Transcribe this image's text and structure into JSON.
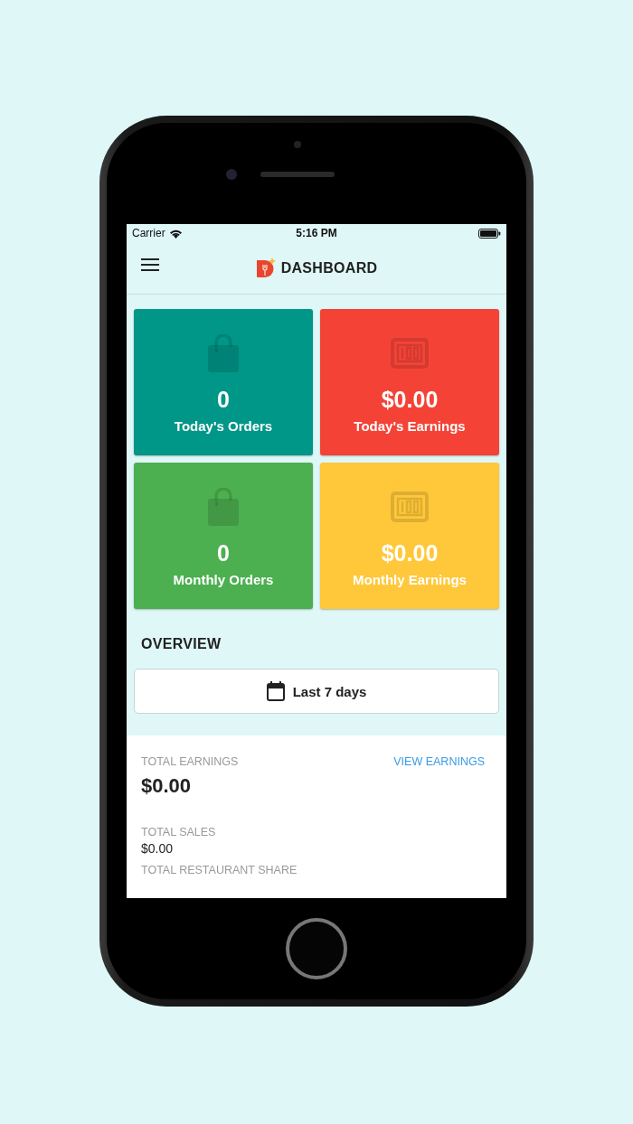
{
  "status_bar": {
    "carrier": "Carrier",
    "time": "5:16 PM"
  },
  "nav_bar": {
    "title": "DASHBOARD"
  },
  "cards": [
    {
      "value": "0",
      "label": "Today's Orders",
      "kind": "orders",
      "color": "#009688"
    },
    {
      "value": "$0.00",
      "label": "Today's Earnings",
      "kind": "earnings",
      "color": "#f44336"
    },
    {
      "value": "0",
      "label": "Monthly Orders",
      "kind": "orders",
      "color": "#4caf50"
    },
    {
      "value": "$0.00",
      "label": "Monthly Earnings",
      "kind": "earnings",
      "color": "#ffc83a"
    }
  ],
  "overview": {
    "title": "OVERVIEW",
    "range_button": "Last 7 days",
    "total_earnings_label": "TOTAL EARNINGS",
    "view_earnings_link": "VIEW EARNINGS",
    "total_earnings": "$0.00",
    "stats": [
      {
        "label": "TOTAL SALES",
        "value": "$0.00"
      },
      {
        "label": "TOTAL RESTAURANT SHARE"
      }
    ]
  }
}
